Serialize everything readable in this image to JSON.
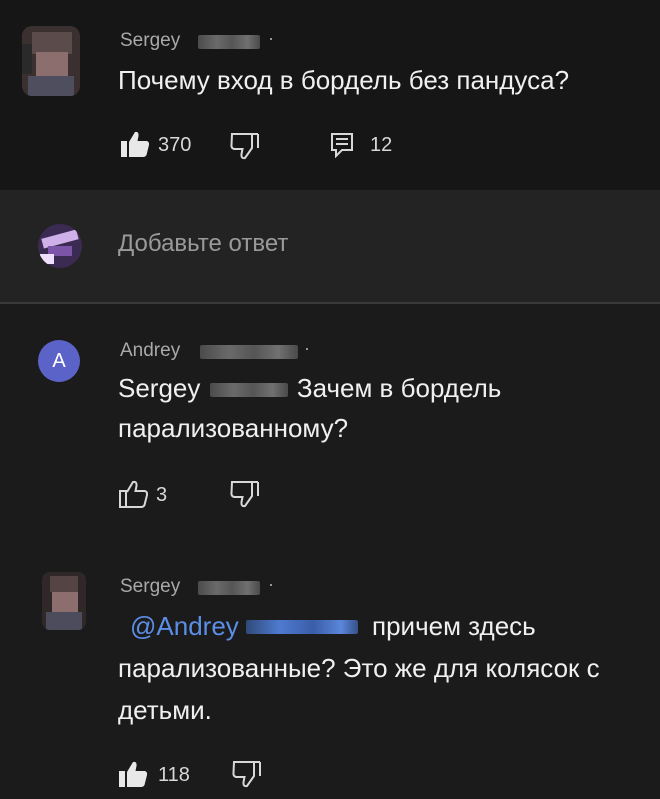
{
  "comment": {
    "username": "Sergey",
    "text": "Почему вход в бордель без пандуса?",
    "likes": "370",
    "replies": "12"
  },
  "reply_box": {
    "placeholder": "Добавьте ответ"
  },
  "replies": [
    {
      "username": "Andrey",
      "avatar_letter": "A",
      "mention": "Sergey",
      "text_line1": "Зачем в бордель",
      "text_line2": "парализованному?",
      "likes": "3"
    },
    {
      "username": "Sergey",
      "mention": "@Andrey",
      "text_line1": "причем здесь",
      "text_line2": "парализованные? Это же для колясок с",
      "text_line3": "детьми.",
      "likes": "118"
    }
  ],
  "colors": {
    "background": "#1e1e1e",
    "mention": "#5b8ee6",
    "avatar_andrey": "#5c63c8"
  },
  "icons": [
    "like-icon",
    "dislike-icon",
    "reply-icon"
  ]
}
